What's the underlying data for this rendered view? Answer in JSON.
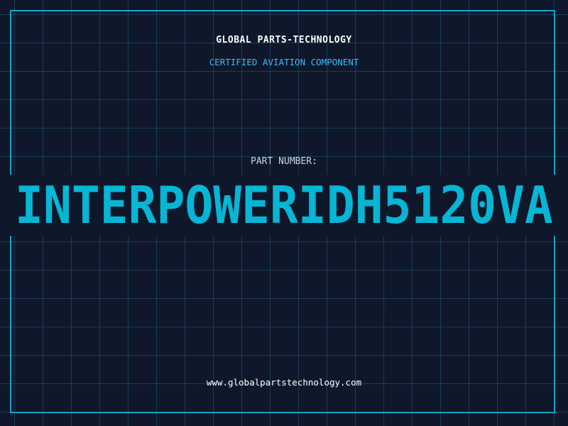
{
  "header": {
    "company_name": "GLOBAL PARTS-TECHNOLOGY",
    "tagline": "CERTIFIED AVIATION COMPONENT"
  },
  "part": {
    "label": "PART NUMBER:",
    "number": "INTERPOWERIDH5120VA"
  },
  "footer": {
    "website": "www.globalpartstechnology.com"
  },
  "colors": {
    "background": "#0f172a",
    "accent": "#06b6d4",
    "grid": "#38bdf8",
    "text": "#ffffff"
  }
}
